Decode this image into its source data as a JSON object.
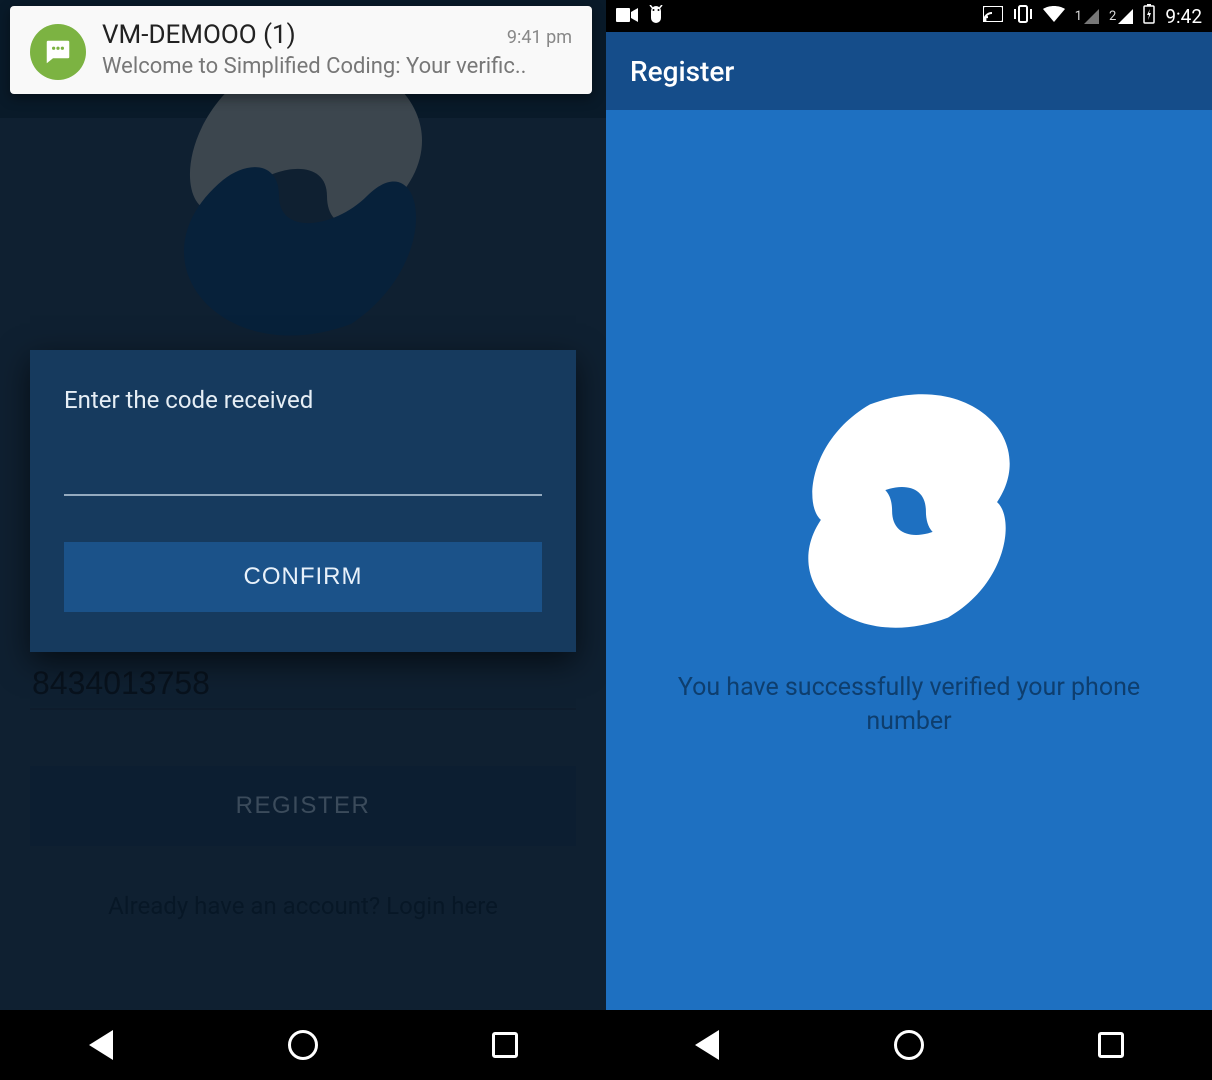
{
  "left": {
    "notification": {
      "title": "VM-DEMOOO (1)",
      "time": "9:41 pm",
      "body": "Welcome to Simplified Coding: Your verific.."
    },
    "dialog": {
      "title": "Enter the code received",
      "confirm_label": "CONFIRM"
    },
    "form": {
      "phone_value": "8434013758",
      "register_label": "REGISTER",
      "login_link": "Already have an account? Login here"
    }
  },
  "right": {
    "status": {
      "time": "9:42",
      "sim1": "1",
      "sim2": "2"
    },
    "toolbar": {
      "title": "Register"
    },
    "success_message": "You have successfully verified your phone number"
  }
}
